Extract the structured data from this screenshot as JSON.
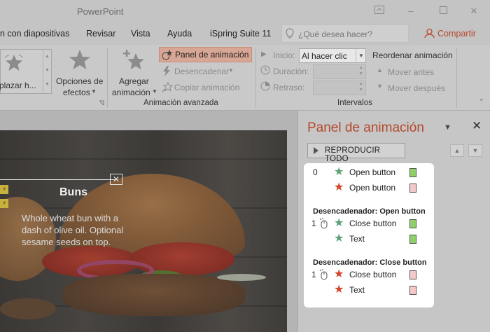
{
  "window": {
    "title": "PowerPoint"
  },
  "tabs": [
    {
      "label": "n con diapositivas"
    },
    {
      "label": "Revisar"
    },
    {
      "label": "Vista"
    },
    {
      "label": "Ayuda"
    },
    {
      "label": "iSpring Suite 11"
    }
  ],
  "tellme": {
    "placeholder": "¿Qué desea hacer?"
  },
  "share": {
    "label": "Compartir"
  },
  "ribbon": {
    "gallery_label": "plazar h...",
    "effect_options": {
      "line1": "Opciones de",
      "line2": "efectos"
    },
    "add_animation": {
      "line1": "Agregar",
      "line2": "animación"
    },
    "animation_pane_button": "Panel de animación",
    "trigger_button": "Desencadenar",
    "animation_painter": "Copiar animación",
    "advanced_group_label": "Animación avanzada",
    "start_label": "Inicio:",
    "start_value": "Al hacer clic",
    "duration_label": "Duración:",
    "delay_label": "Retraso:",
    "timing_group_label": "Intervalos",
    "reorder_label": "Reordenar animación",
    "move_earlier": "Mover antes",
    "move_later": "Mover después"
  },
  "slide": {
    "title": "Buns",
    "description": "Whole wheat bun with a dash of olive oil. Optional sesame seeds on top."
  },
  "pane": {
    "title": "Panel de animación",
    "play_all": "REPRODUCIR TODO",
    "colors": {
      "green_star": "#5aa377",
      "red_star": "#d4432a",
      "green_box": "#8ed16a",
      "red_box": "#f6c8c8"
    },
    "items": [
      {
        "num": "0",
        "label": "Open button",
        "effect": "entrance"
      },
      {
        "num": "",
        "label": "Open button",
        "effect": "emphasis"
      },
      {
        "num": "1",
        "label": "Close button",
        "effect": "entrance"
      },
      {
        "num": "",
        "label": "Text",
        "effect": "entrance"
      },
      {
        "num": "1",
        "label": "Close button",
        "effect": "emphasis"
      },
      {
        "num": "",
        "label": "Text",
        "effect": "emphasis"
      }
    ],
    "triggers": [
      {
        "label": "Desencadenador: Open button"
      },
      {
        "label": "Desencadenador: Close button"
      }
    ]
  }
}
